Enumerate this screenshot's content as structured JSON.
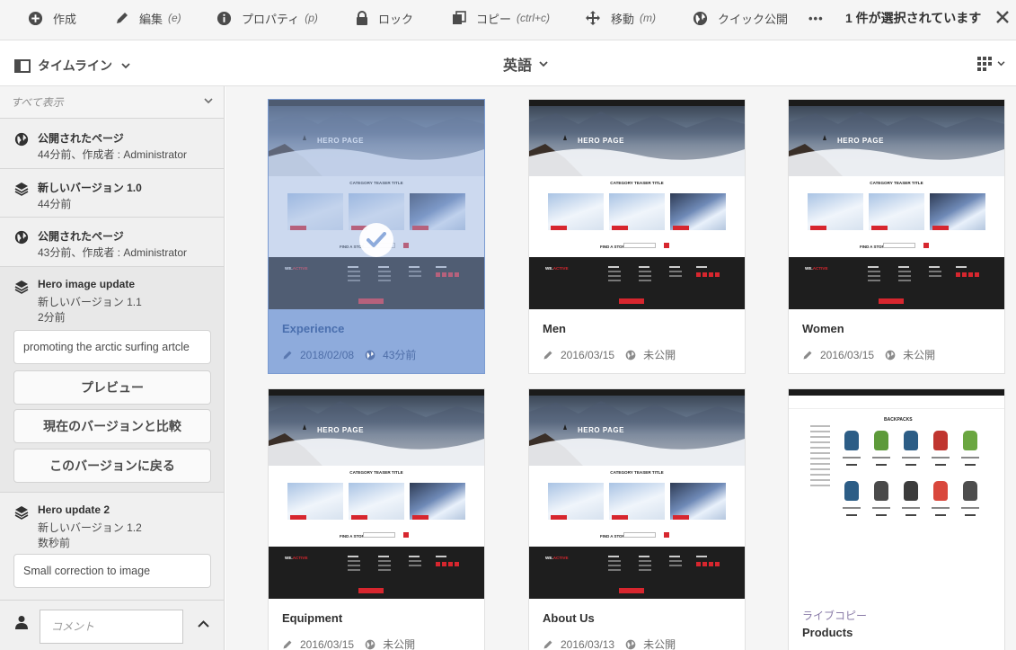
{
  "actionbar": {
    "create": "作成",
    "edit": "編集",
    "edit_key": "(e)",
    "properties": "プロパティ",
    "properties_key": "(p)",
    "lock": "ロック",
    "copy": "コピー",
    "copy_key": "(ctrl+c)",
    "move": "移動",
    "move_key": "(m)",
    "quick_publish": "クイック公開",
    "more": "•••",
    "selection_count": "1 件が選択されています"
  },
  "subbar": {
    "rail_label": "タイムライン",
    "title": "英語"
  },
  "timeline": {
    "filter": "すべて表示",
    "entries": [
      {
        "title": "公開されたページ",
        "line2": "44分前、作成者 : Administrator",
        "icon": "globe-icon"
      },
      {
        "title": "新しいバージョン 1.0",
        "line2": "44分前",
        "icon": "layers-icon"
      },
      {
        "title": "公開されたページ",
        "line2": "43分前、作成者 : Administrator",
        "icon": "globe-icon"
      },
      {
        "title": "Hero image update",
        "line2": "新しいバージョン 1.1",
        "line3": "2分前",
        "icon": "layers-icon"
      },
      {
        "title": "Hero update 2",
        "line2": "新しいバージョン 1.2",
        "line3": "数秒前",
        "icon": "layers-icon"
      }
    ],
    "entry4_comment": "promoting the arctic surfing artcle",
    "preview_label": "プレビュー",
    "compare_label": "現在のバージョンと比較",
    "revert_label": "このバージョンに戻る",
    "entry5_comment": "Small correction to image",
    "comment_placeholder": "コメント"
  },
  "thumbs": {
    "hero_title": "HERO PAGE",
    "category_title": "CATEGORY TEASER TITLE",
    "find_store": "FIND A STORE",
    "brand_a": "WE.",
    "brand_b": "ACTIVE",
    "products_title": "BACKPACKS"
  },
  "cards": [
    {
      "name": "Experience",
      "date": "2018/02/08",
      "status": "43分前",
      "selected": true
    },
    {
      "name": "Men",
      "date": "2016/03/15",
      "status": "未公開"
    },
    {
      "name": "Women",
      "date": "2016/03/15",
      "status": "未公開"
    },
    {
      "name": "Equipment",
      "date": "2016/03/15",
      "status": "未公開"
    },
    {
      "name": "About Us",
      "date": "2016/03/13",
      "status": "未公開"
    },
    {
      "name": "Products",
      "subtitle": "ライブコピー"
    }
  ],
  "colors": {
    "selection": "#8eabdc",
    "accent_red": "#d7262e",
    "footer_dark": "#1e1e1e"
  }
}
